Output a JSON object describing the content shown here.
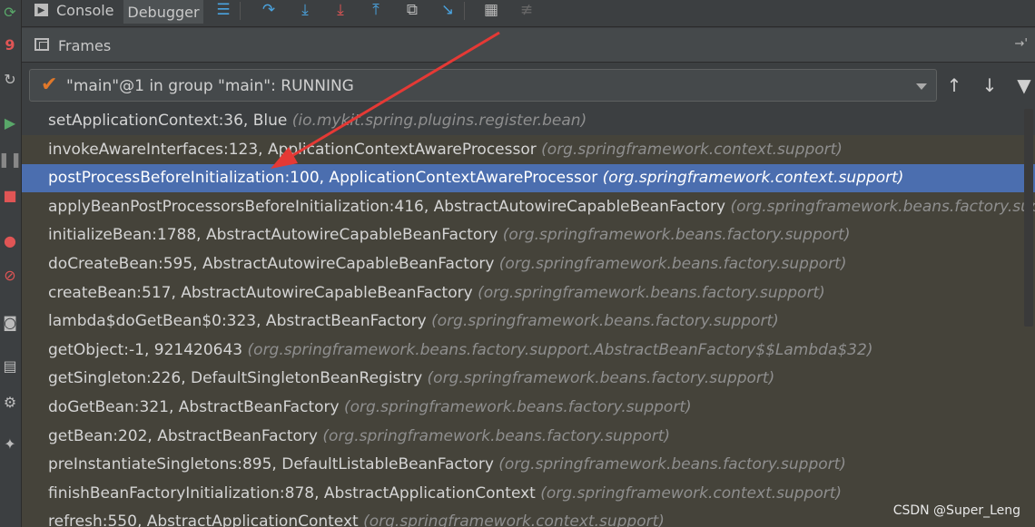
{
  "toolbar": {
    "tabs": [
      {
        "label": "Console",
        "icon": "console-icon"
      },
      {
        "label": "Debugger",
        "icon": null
      }
    ],
    "buttons": [
      {
        "icon": "menu-icon"
      },
      {
        "icon": "step-over-icon"
      },
      {
        "icon": "step-into-icon"
      },
      {
        "icon": "force-step-into-icon"
      },
      {
        "icon": "step-out-icon"
      },
      {
        "icon": "drop-frame-icon"
      },
      {
        "icon": "run-to-cursor-icon"
      },
      {
        "icon": "evaluate-expression-icon"
      },
      {
        "icon": "trace-icon"
      }
    ]
  },
  "left_toolbar": {
    "icons": [
      "rerun-icon",
      "restart-icon",
      "reload-icon",
      "resume-icon",
      "pause-icon",
      "stop-icon",
      "breakpoints-icon",
      "mute-breakpoints-icon",
      "camera-icon",
      "layout-icon",
      "settings-icon",
      "pin-icon"
    ]
  },
  "frames_panel": {
    "title": "Frames",
    "thread_selector": "\"main\"@1 in group \"main\": RUNNING"
  },
  "frames": [
    {
      "method": "setApplicationContext:36, Blue",
      "pkg": "(io.mykit.spring.plugins.register.bean)",
      "selected": false
    },
    {
      "method": "invokeAwareInterfaces:123, ApplicationContextAwareProcessor",
      "pkg": "(org.springframework.context.support)",
      "selected": false
    },
    {
      "method": "postProcessBeforeInitialization:100, ApplicationContextAwareProcessor",
      "pkg": "(org.springframework.context.support)",
      "selected": true
    },
    {
      "method": "applyBeanPostProcessorsBeforeInitialization:416, AbstractAutowireCapableBeanFactory",
      "pkg": "(org.springframework.beans.factory.support)",
      "selected": false
    },
    {
      "method": "initializeBean:1788, AbstractAutowireCapableBeanFactory",
      "pkg": "(org.springframework.beans.factory.support)",
      "selected": false
    },
    {
      "method": "doCreateBean:595, AbstractAutowireCapableBeanFactory",
      "pkg": "(org.springframework.beans.factory.support)",
      "selected": false
    },
    {
      "method": "createBean:517, AbstractAutowireCapableBeanFactory",
      "pkg": "(org.springframework.beans.factory.support)",
      "selected": false
    },
    {
      "method": "lambda$doGetBean$0:323, AbstractBeanFactory",
      "pkg": "(org.springframework.beans.factory.support)",
      "selected": false
    },
    {
      "method": "getObject:-1, 921420643",
      "pkg": "(org.springframework.beans.factory.support.AbstractBeanFactory$$Lambda$32)",
      "selected": false
    },
    {
      "method": "getSingleton:226, DefaultSingletonBeanRegistry",
      "pkg": "(org.springframework.beans.factory.support)",
      "selected": false
    },
    {
      "method": "doGetBean:321, AbstractBeanFactory",
      "pkg": "(org.springframework.beans.factory.support)",
      "selected": false
    },
    {
      "method": "getBean:202, AbstractBeanFactory",
      "pkg": "(org.springframework.beans.factory.support)",
      "selected": false
    },
    {
      "method": "preInstantiateSingletons:895, DefaultListableBeanFactory",
      "pkg": "(org.springframework.beans.factory.support)",
      "selected": false
    },
    {
      "method": "finishBeanFactoryInitialization:878, AbstractApplicationContext",
      "pkg": "(org.springframework.context.support)",
      "selected": false
    },
    {
      "method": "refresh:550, AbstractApplicationContext",
      "pkg": "(org.springframework.context.support)",
      "selected": false
    }
  ],
  "watermark": "CSDN @Super_Leng",
  "colors": {
    "selection": "#4b6eaf",
    "annotation_arrow": "#e53935",
    "check": "#e0782a"
  }
}
